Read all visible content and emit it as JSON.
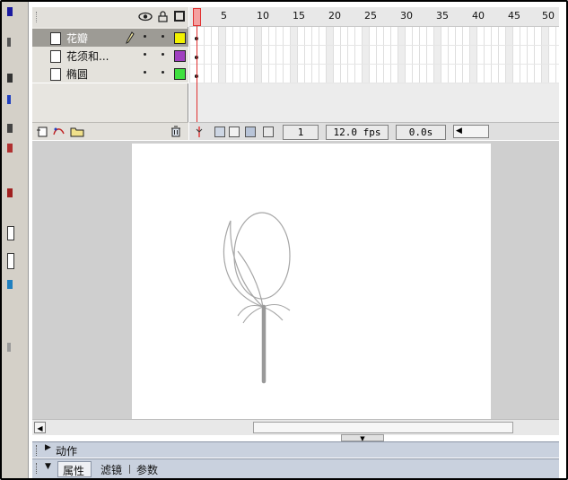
{
  "layers": [
    {
      "name": "花瓣",
      "selected": true,
      "color": "#f2f200"
    },
    {
      "name": "花须和...",
      "selected": false,
      "color": "#a040c0"
    },
    {
      "name": "椭圆",
      "selected": false,
      "color": "#40e040"
    }
  ],
  "timeline": {
    "frame_numbers": [
      "1",
      "5",
      "10",
      "15",
      "20",
      "25",
      "30",
      "35",
      "40",
      "45",
      "50"
    ],
    "current_frame": "1",
    "fps": "12.0 fps",
    "time": "0.0s"
  },
  "panels": {
    "actions": "动作",
    "properties": "属性",
    "filters": "滤镜",
    "parameters": "参数"
  },
  "colors": {
    "selected_layer": "#9d9b95",
    "playhead": "#e03030",
    "stage_bg": "#ffffff",
    "workspace": "#cfcfcf"
  }
}
